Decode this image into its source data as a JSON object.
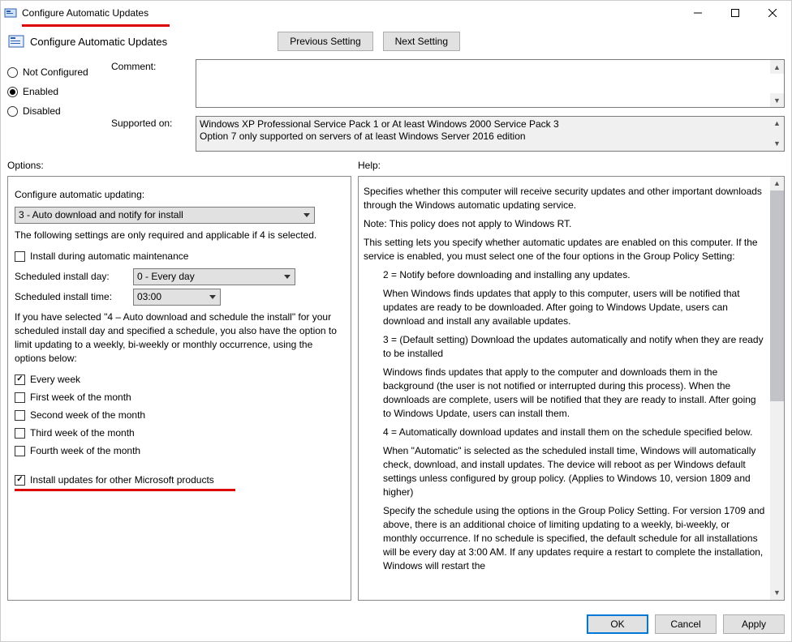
{
  "window": {
    "title": "Configure Automatic Updates"
  },
  "subtitle": "Configure Automatic Updates",
  "nav": {
    "prev": "Previous Setting",
    "next": "Next Setting"
  },
  "state": {
    "not_configured": "Not Configured",
    "enabled": "Enabled",
    "disabled": "Disabled",
    "selected": "enabled"
  },
  "comment_label": "Comment:",
  "supported_label": "Supported on:",
  "supported_text_1": "Windows XP Professional Service Pack 1 or At least Windows 2000 Service Pack 3",
  "supported_text_2": "Option 7 only supported on servers of at least Windows Server 2016 edition",
  "options_header": "Options:",
  "help_header": "Help:",
  "options": {
    "configure_label": "Configure automatic updating:",
    "configure_value": "3 - Auto download and notify for install",
    "note4": "The following settings are only required and applicable if 4 is selected.",
    "install_maint": "Install during automatic maintenance",
    "sched_day_label": "Scheduled install day:",
    "sched_day_value": "0 - Every day",
    "sched_time_label": "Scheduled install time:",
    "sched_time_value": "03:00",
    "para_sched": "If you have selected \"4 – Auto download and schedule the install\" for your scheduled install day and specified a schedule, you also have the option to limit updating to a weekly, bi-weekly or monthly occurrence, using the options below:",
    "every_week": "Every week",
    "first_week": "First week of the month",
    "second_week": "Second week of the month",
    "third_week": "Third week of the month",
    "fourth_week": "Fourth week of the month",
    "other_ms": "Install updates for other Microsoft products"
  },
  "help": {
    "p1": "Specifies whether this computer will receive security updates and other important downloads through the Windows automatic updating service.",
    "p2": "Note: This policy does not apply to Windows RT.",
    "p3": "This setting lets you specify whether automatic updates are enabled on this computer. If the service is enabled, you must select one of the four options in the Group Policy Setting:",
    "p4": "2 = Notify before downloading and installing any updates.",
    "p5": "When Windows finds updates that apply to this computer, users will be notified that updates are ready to be downloaded. After going to Windows Update, users can download and install any available updates.",
    "p6": "3 = (Default setting) Download the updates automatically and notify when they are ready to be installed",
    "p7": "Windows finds updates that apply to the computer and downloads them in the background (the user is not notified or interrupted during this process). When the downloads are complete, users will be notified that they are ready to install. After going to Windows Update, users can install them.",
    "p8": "4 = Automatically download updates and install them on the schedule specified below.",
    "p9": "When \"Automatic\" is selected as the scheduled install time, Windows will automatically check, download, and install updates. The device will reboot as per Windows default settings unless configured by group policy. (Applies to Windows 10, version 1809 and higher)",
    "p10": "Specify the schedule using the options in the Group Policy Setting. For version 1709 and above, there is an additional choice of limiting updating to a weekly, bi-weekly, or monthly occurrence. If no schedule is specified, the default schedule for all installations will be every day at 3:00 AM. If any updates require a restart to complete the installation, Windows will restart the"
  },
  "footer": {
    "ok": "OK",
    "cancel": "Cancel",
    "apply": "Apply"
  }
}
